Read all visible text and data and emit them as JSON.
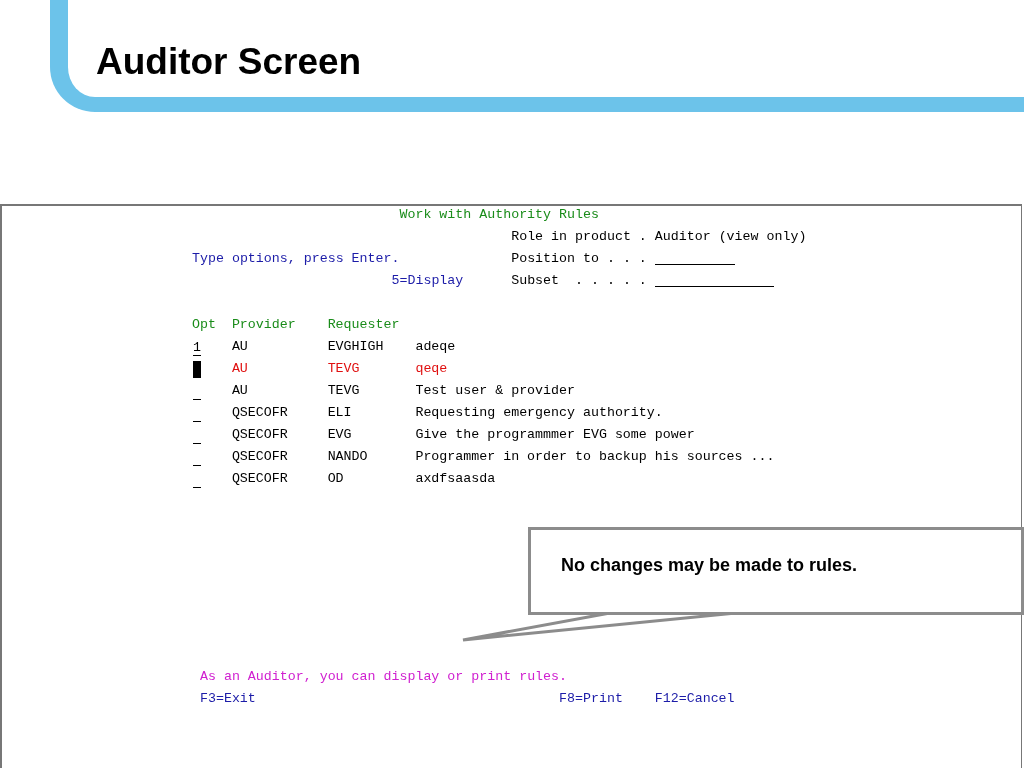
{
  "slide": {
    "title": "Auditor Screen"
  },
  "terminal": {
    "title": "Work with Authority Rules",
    "info": [
      {
        "label": "Role in product .",
        "value": "Auditor (view only)",
        "kind": "text"
      },
      {
        "label": "Position to . . .",
        "kind": "field"
      },
      {
        "label": "Subset  . . . . .",
        "kind": "field"
      }
    ],
    "instruction": "Type options, press Enter.",
    "options": "5=Display",
    "columns": [
      "Opt",
      "Provider",
      "Requester"
    ],
    "rows": [
      {
        "option": "1",
        "cursor": false,
        "highlighted": false,
        "provider": "AU",
        "requester": "EVGHIGH",
        "description": "adeqe"
      },
      {
        "cursor": true,
        "highlighted": true,
        "provider": "AU",
        "requester": "TEVG",
        "description": "qeqe"
      },
      {
        "cursor": false,
        "highlighted": false,
        "provider": "AU",
        "requester": "TEVG",
        "description": "Test user & provider"
      },
      {
        "cursor": false,
        "highlighted": false,
        "provider": "QSECOFR",
        "requester": "ELI",
        "description": "Requesting emergency authority."
      },
      {
        "cursor": false,
        "highlighted": false,
        "provider": "QSECOFR",
        "requester": "EVG",
        "description": "Give the programmmer EVG some power"
      },
      {
        "cursor": false,
        "highlighted": false,
        "provider": "QSECOFR",
        "requester": "NANDO",
        "description": "Programmer in order to backup his sources ..."
      },
      {
        "cursor": false,
        "highlighted": false,
        "provider": "QSECOFR",
        "requester": "OD",
        "description": "axdfsaasda"
      }
    ],
    "message": "As an Auditor, you can display or print rules.",
    "function_keys": [
      {
        "label": "F3=Exit"
      },
      {
        "label": "F8=Print"
      },
      {
        "label": "F12=Cancel"
      }
    ]
  },
  "callout": {
    "text": "No changes may be made to rules."
  }
}
